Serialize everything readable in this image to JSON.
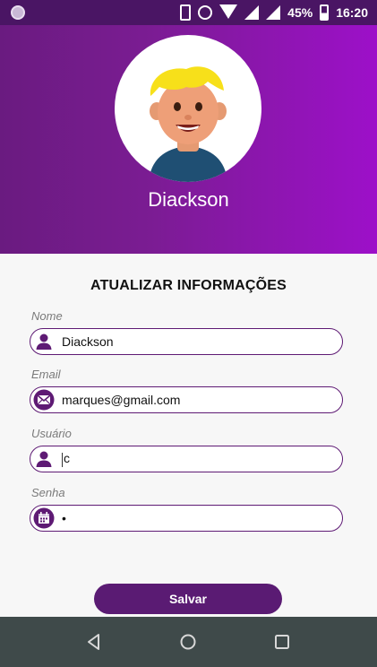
{
  "status_bar": {
    "battery": "45%",
    "time": "16:20",
    "icons": [
      "app-notification-icon",
      "vibrate-icon",
      "alarm-icon",
      "wifi-icon",
      "signal-icon",
      "signal-icon",
      "battery-charging-icon"
    ]
  },
  "profile": {
    "name": "Diackson",
    "avatar_icon": "boy-avatar-icon"
  },
  "form": {
    "title": "ATUALIZAR INFORMAÇÕES",
    "fields": [
      {
        "label": "Nome",
        "value": "Diackson",
        "icon": "person-icon"
      },
      {
        "label": "Email",
        "value": "marques@gmail.com",
        "icon": "envelope-icon"
      },
      {
        "label": "Usuário",
        "value": "c",
        "icon": "person-icon"
      },
      {
        "label": "Senha",
        "value": "•",
        "icon": "calendar-icon"
      }
    ],
    "save_label": "Salvar"
  },
  "nav": {
    "buttons": [
      "back-icon",
      "home-icon",
      "recents-icon"
    ]
  },
  "colors": {
    "header_start": "#6a1b80",
    "header_end": "#9d10c9",
    "accent": "#5a1b73",
    "nav_bar": "#3f4a4a"
  }
}
